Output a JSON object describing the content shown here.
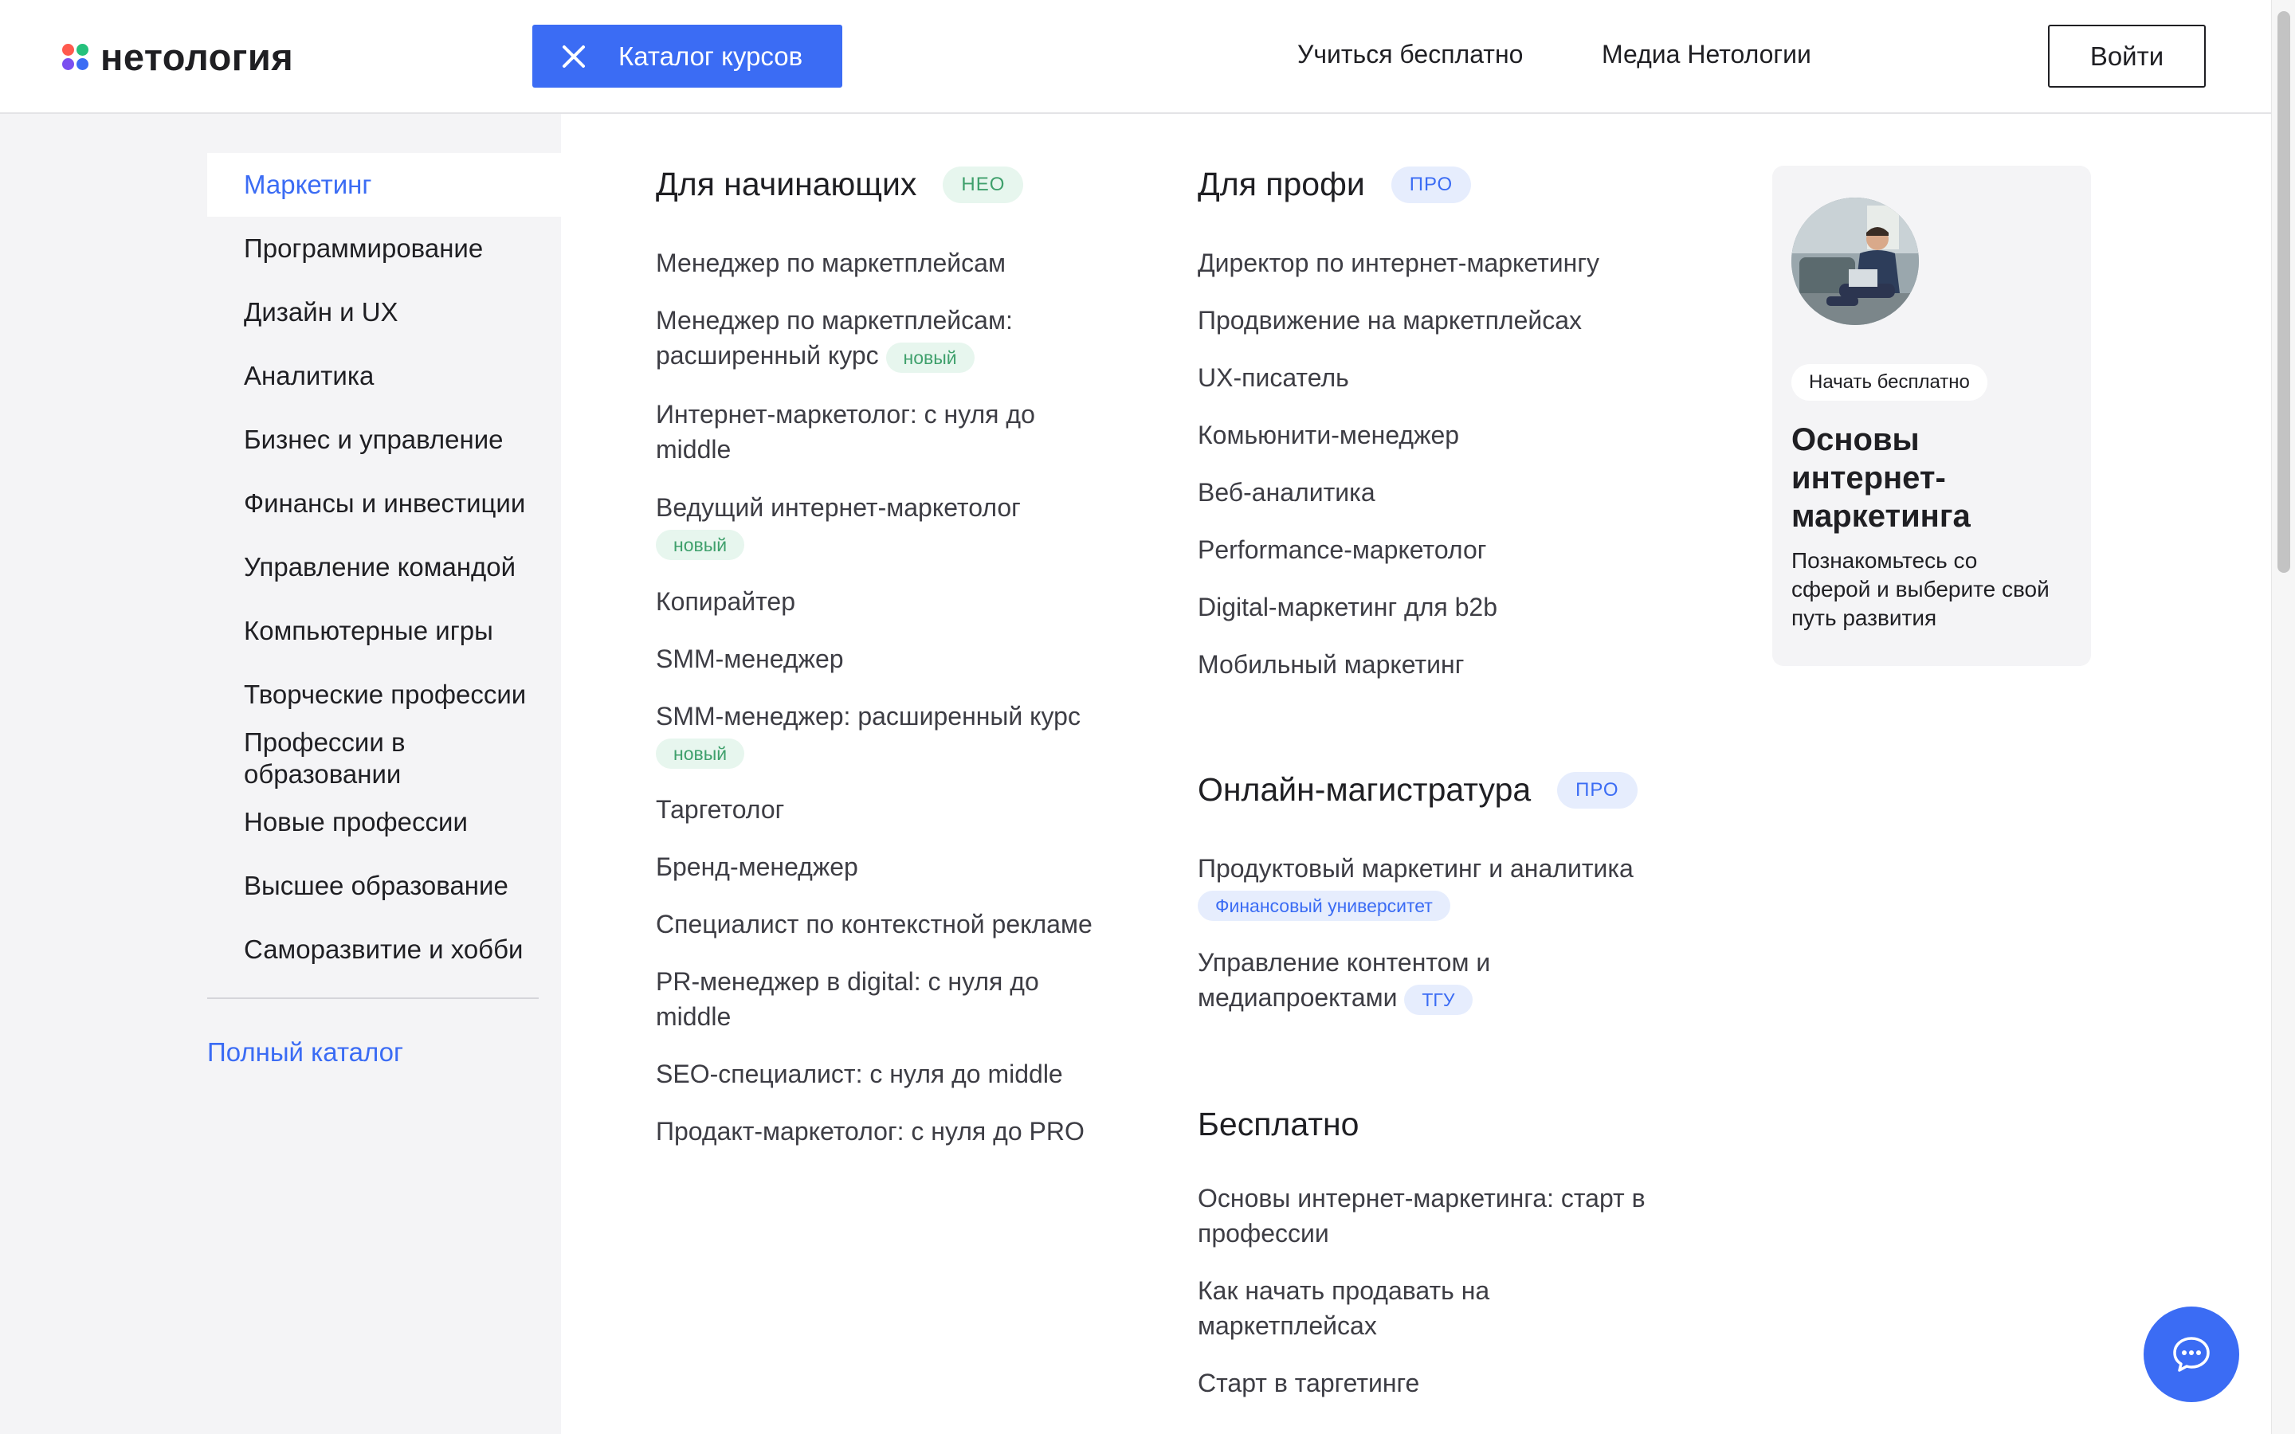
{
  "header": {
    "logo_text": "нетология",
    "catalog_button": "Каталог курсов",
    "links": [
      "Учиться бесплатно",
      "Медиа Нетологии"
    ],
    "login_button": "Войти"
  },
  "sidebar": {
    "items": [
      {
        "label": "Маркетинг",
        "active": true
      },
      {
        "label": "Программирование"
      },
      {
        "label": "Дизайн и UX"
      },
      {
        "label": "Аналитика"
      },
      {
        "label": "Бизнес и управление"
      },
      {
        "label": "Финансы и инвестиции"
      },
      {
        "label": "Управление командой"
      },
      {
        "label": "Компьютерные игры"
      },
      {
        "label": "Творческие профессии"
      },
      {
        "label": "Профессии в образовании"
      },
      {
        "label": "Новые профессии"
      },
      {
        "label": "Высшее образование"
      },
      {
        "label": "Саморазвитие и хобби"
      }
    ],
    "full_catalog": "Полный каталог"
  },
  "beginners": {
    "title": "Для начинающих",
    "badge": "НЕО",
    "courses": [
      {
        "label": "Менеджер по маркетплейсам"
      },
      {
        "label": "Менеджер по маркетплейсам: расширенный курс",
        "tag": "новый"
      },
      {
        "label": "Интернет-маркетолог: с нуля до middle"
      },
      {
        "label": "Ведущий интернет-маркетолог",
        "tag": "новый"
      },
      {
        "label": "Копирайтер"
      },
      {
        "label": "SMM-менеджер"
      },
      {
        "label": "SMM-менеджер: расширенный курс",
        "tag": "новый"
      },
      {
        "label": "Таргетолог"
      },
      {
        "label": "Бренд-менеджер"
      },
      {
        "label": "Специалист по контекстной рекламе"
      },
      {
        "label": "PR-менеджер в digital: с нуля до middle"
      },
      {
        "label": "SEO-специалист: с нуля до middle"
      },
      {
        "label": "Продакт-маркетолог: с нуля до PRO"
      }
    ]
  },
  "pros": {
    "title": "Для профи",
    "badge": "ПРО",
    "courses": [
      {
        "label": "Директор по интернет-маркетингу"
      },
      {
        "label": "Продвижение на маркетплейсах"
      },
      {
        "label": "UX-писатель"
      },
      {
        "label": "Комьюнити-менеджер"
      },
      {
        "label": "Веб-аналитика"
      },
      {
        "label": "Performance-маркетолог"
      },
      {
        "label": "Digital-маркетинг для b2b"
      },
      {
        "label": "Мобильный маркетинг"
      }
    ]
  },
  "masters": {
    "title": "Онлайн-магистратура",
    "badge": "ПРО",
    "courses": [
      {
        "label": "Продуктовый маркетинг и аналитика",
        "tag": "Финансовый университет"
      },
      {
        "label": "Управление контентом и медиапроектами",
        "tag": "ТГУ"
      }
    ]
  },
  "free": {
    "title": "Бесплатно",
    "courses": [
      {
        "label": "Основы интернет-маркетинга: старт в профессии"
      },
      {
        "label": "Как начать продавать на маркетплейсах"
      },
      {
        "label": "Старт в таргетинге"
      }
    ]
  },
  "promo": {
    "pill": "Начать бесплатно",
    "title": "Основы интернет-маркетинга",
    "description": "Познакомьтесь со сферой и выберите свой путь развития"
  },
  "icons": {
    "close": "close-icon",
    "chat": "chat-icon",
    "logo": "logo-mark-icon"
  },
  "colors": {
    "accent": "#3b6cf4",
    "neo_badge": "#3fa06c",
    "sidebar_bg": "#f4f4f6"
  }
}
